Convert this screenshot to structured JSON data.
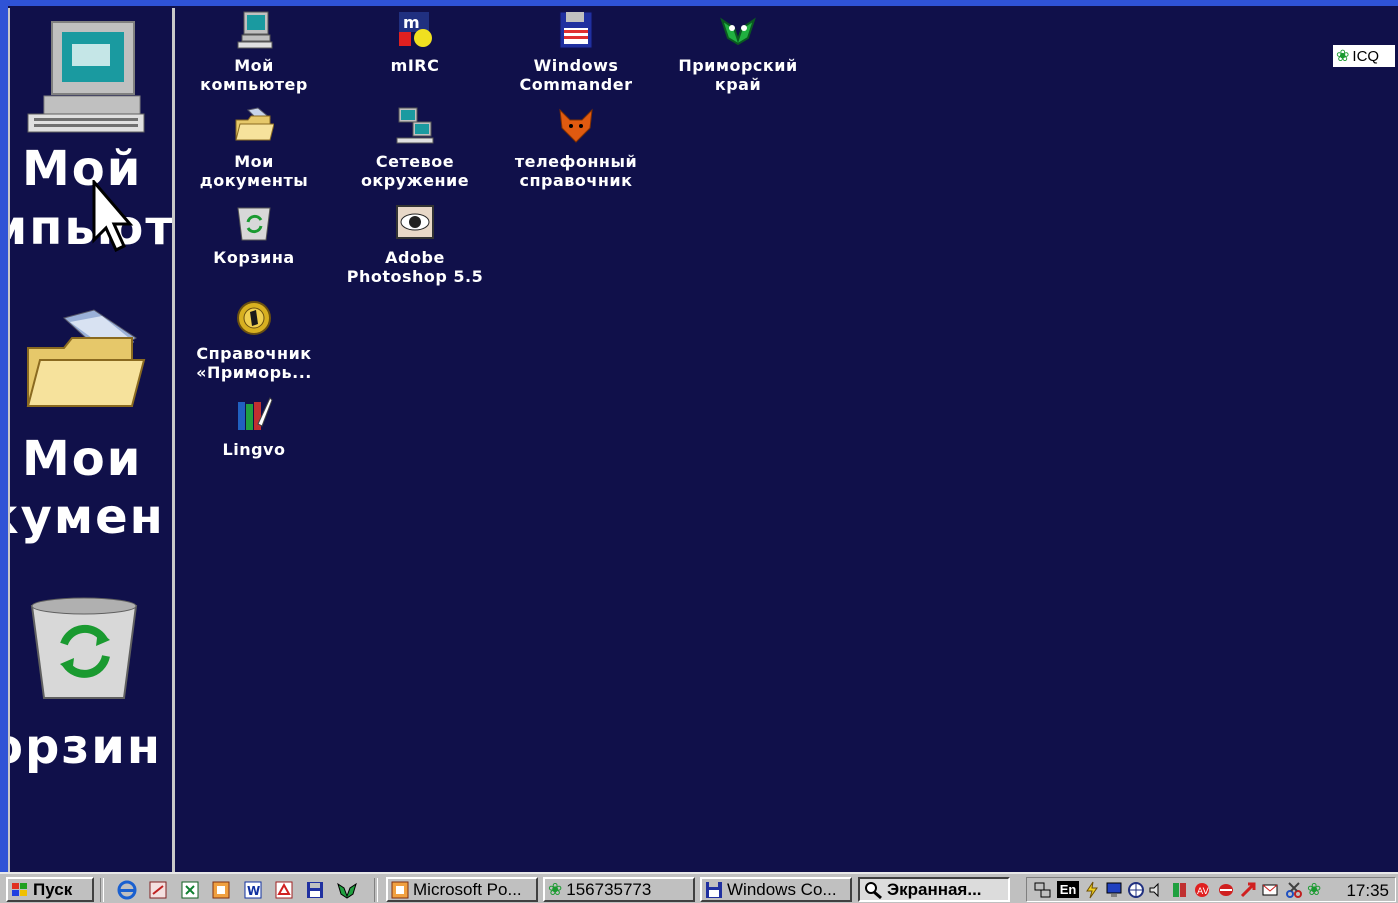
{
  "magnifier": {
    "lines": [
      "Мой",
      "мпьют",
      "Мои",
      "кумен",
      "орзин"
    ]
  },
  "desktop_icons": [
    {
      "name": "my-computer",
      "label": "Мой\nкомпьютер",
      "icon": "computer-icon"
    },
    {
      "name": "my-documents",
      "label": "Мои\nдокументы",
      "icon": "folder-icon"
    },
    {
      "name": "recycle-bin",
      "label": "Корзина",
      "icon": "recycle-bin-icon"
    },
    {
      "name": "spravochnik",
      "label": "Справочник\n«Приморь...",
      "icon": "info-disk-icon"
    },
    {
      "name": "lingvo",
      "label": "Lingvo",
      "icon": "books-icon"
    },
    {
      "name": "mirc",
      "label": "mIRC",
      "icon": "mirc-icon"
    },
    {
      "name": "network",
      "label": "Сетевое\nокружение",
      "icon": "network-icon"
    },
    {
      "name": "photoshop",
      "label": "Adobe\nPhotoshop 5.5",
      "icon": "eye-icon"
    },
    {
      "name": "windows-commander",
      "label": "Windows\nCommander",
      "icon": "floppy-icon"
    },
    {
      "name": "phone-directory",
      "label": "телефонный\nсправочник",
      "icon": "fox-icon"
    },
    {
      "name": "primorsky",
      "label": "Приморский\nкрай",
      "icon": "tiger-icon"
    }
  ],
  "icq_button": {
    "label": "ICQ",
    "icon": "flower-icon"
  },
  "taskbar": {
    "start_label": "Пуск",
    "quick_launch": [
      "ie-icon",
      "outlook-icon",
      "excel-icon",
      "powerpoint-icon",
      "word-icon",
      "acrobat-icon",
      "save-icon",
      "tiger-icon"
    ],
    "tasks": [
      {
        "label": "Microsoft Po...",
        "icon": "powerpoint-icon",
        "active": false
      },
      {
        "label": "156735773",
        "icon": "flower-icon",
        "active": false
      },
      {
        "label": "Windows Co...",
        "icon": "floppy-icon",
        "active": false
      },
      {
        "label": "Экранная...",
        "icon": "magnifier-icon",
        "active": true
      }
    ],
    "tray_icons": [
      "network-tray-icon",
      "language-icon",
      "power-icon",
      "monitor-icon",
      "globe-icon",
      "volume-icon",
      "book-icon",
      "antivirus-icon",
      "app-icon",
      "arrow-icon",
      "mail-icon",
      "scissors-icon",
      "flower-icon"
    ],
    "language": "En",
    "clock": "17:35"
  },
  "colors": {
    "desktop": "#10104a",
    "taskbar": "#c0c0c0",
    "frame": "#2f53d6"
  }
}
